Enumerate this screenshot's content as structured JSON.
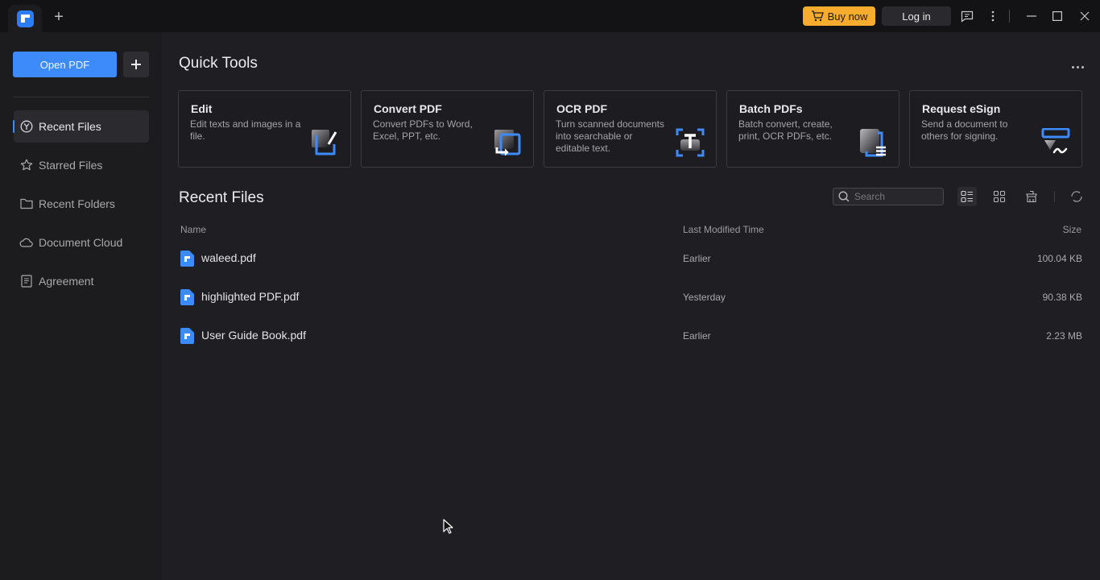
{
  "titlebar": {
    "new_tab_label": "+",
    "buy_now_label": "Buy now",
    "login_label": "Log in",
    "icons": [
      "app-logo",
      "new-tab-plus",
      "cart-icon",
      "feedback-icon",
      "more-vertical-icon",
      "minimize-icon",
      "maximize-icon",
      "close-icon"
    ]
  },
  "sidebar": {
    "open_pdf_label": "Open PDF",
    "add_label": "+",
    "items": [
      {
        "label": "Recent Files",
        "icon": "clock-icon",
        "active": true
      },
      {
        "label": "Starred Files",
        "icon": "star-icon",
        "active": false
      },
      {
        "label": "Recent Folders",
        "icon": "folder-icon",
        "active": false
      },
      {
        "label": "Document Cloud",
        "icon": "cloud-icon",
        "active": false
      },
      {
        "label": "Agreement",
        "icon": "agreement-icon",
        "active": false
      }
    ]
  },
  "quick_tools": {
    "title": "Quick Tools",
    "more_label": "...",
    "tools": [
      {
        "title": "Edit",
        "description": "Edit texts and images in a file.",
        "icon": "edit-icon"
      },
      {
        "title": "Convert PDF",
        "description": "Convert PDFs to Word, Excel, PPT, etc.",
        "icon": "convert-icon"
      },
      {
        "title": "OCR PDF",
        "description": "Turn scanned documents into searchable or editable text.",
        "icon": "ocr-icon"
      },
      {
        "title": "Batch PDFs",
        "description": "Batch convert, create, print, OCR PDFs, etc.",
        "icon": "batch-icon"
      },
      {
        "title": "Request eSign",
        "description": "Send a document to others for signing.",
        "icon": "esign-icon"
      }
    ]
  },
  "recent_files": {
    "title": "Recent Files",
    "search_placeholder": "Search",
    "view_mode": "list",
    "columns": {
      "name": "Name",
      "modified": "Last Modified Time",
      "size": "Size"
    },
    "files": [
      {
        "name": "waleed.pdf",
        "modified": "Earlier",
        "size": "100.04 KB"
      },
      {
        "name": "highlighted PDF.pdf",
        "modified": "Yesterday",
        "size": "90.38 KB"
      },
      {
        "name": "User Guide Book.pdf",
        "modified": "Earlier",
        "size": "2.23 MB"
      }
    ]
  },
  "colors": {
    "accent": "#3d8bfa",
    "buy_now": "#f7ac2e",
    "background": "#1f1f23",
    "sidebar": "#1c1c1f",
    "titlebar": "#131316"
  }
}
